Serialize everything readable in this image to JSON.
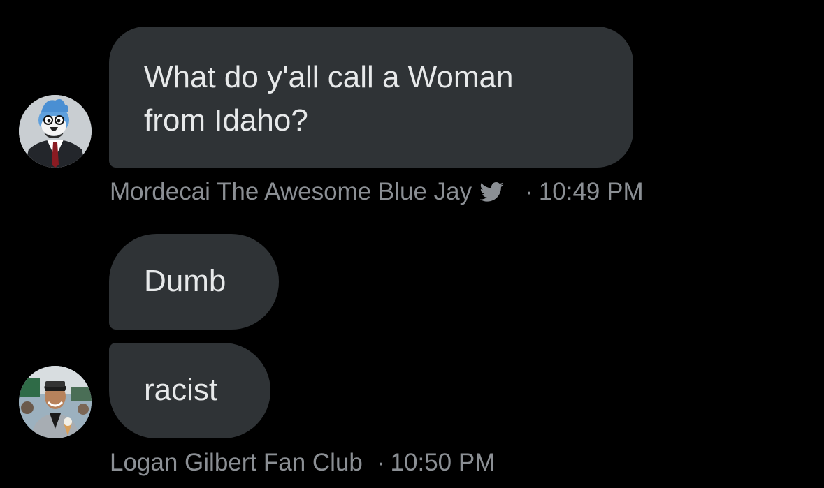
{
  "messages": [
    {
      "lines": [
        "What do y'all call a Woman",
        "from Idaho?"
      ],
      "sender": "Mordecai The Awesome Blue Jay",
      "verified_icon": "twitter-bird-icon",
      "separator": "·",
      "time": "10:49 PM"
    },
    {
      "lines": [
        "Dumb"
      ]
    },
    {
      "lines": [
        "racist"
      ],
      "sender": "Logan Gilbert Fan Club",
      "separator": "·",
      "time": "10:50 PM"
    }
  ],
  "colors": {
    "background": "#000000",
    "bubble": "#2f3336",
    "text": "#e7e9ea",
    "meta": "#8b8f94"
  }
}
